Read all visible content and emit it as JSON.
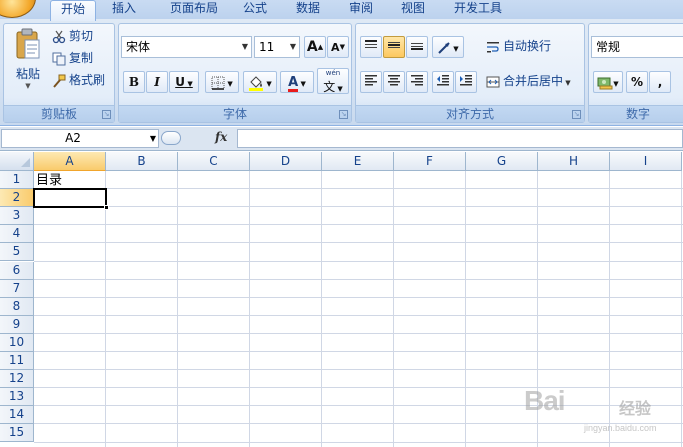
{
  "tabs": [
    {
      "label": "开始",
      "active": true
    },
    {
      "label": "插入",
      "active": false
    },
    {
      "label": "页面布局",
      "active": false
    },
    {
      "label": "公式",
      "active": false
    },
    {
      "label": "数据",
      "active": false
    },
    {
      "label": "审阅",
      "active": false
    },
    {
      "label": "视图",
      "active": false
    },
    {
      "label": "开发工具",
      "active": false
    }
  ],
  "clipboard": {
    "title": "剪贴板",
    "paste_label": "粘贴",
    "cut_label": "剪切",
    "copy_label": "复制",
    "format_painter_label": "格式刷"
  },
  "font": {
    "title": "字体",
    "font_name": "宋体",
    "font_size": "11",
    "bold": "B",
    "italic": "I",
    "underline": "U",
    "font_color_glyph": "A",
    "wen_glyph": "文",
    "wen_sup": "wén",
    "grow_glyph": "A",
    "shrink_glyph": "A",
    "font_color": "#e81c1c",
    "fill_color": "#ffff00"
  },
  "alignment": {
    "title": "对齐方式",
    "wrap_text_label": "自动换行",
    "merge_center_label": "合并后居中"
  },
  "number": {
    "title": "数字",
    "format": "常规",
    "percent_glyph": "%",
    "comma_glyph": ","
  },
  "formula_bar": {
    "name_box": "A2",
    "fx_label": "fx",
    "formula": ""
  },
  "sheet": {
    "columns": [
      "A",
      "B",
      "C",
      "D",
      "E",
      "F",
      "G",
      "H",
      "I"
    ],
    "rows": [
      "1",
      "2",
      "3",
      "4",
      "5",
      "6",
      "7",
      "8",
      "9",
      "10",
      "11",
      "12",
      "13",
      "14",
      "15"
    ],
    "selected_column": "A",
    "selected_row": "2",
    "cells": {
      "A1": "目录"
    }
  },
  "watermark": {
    "brand": "Bai",
    "jingyan": "经验",
    "url": "jingyan.baidu.com"
  }
}
